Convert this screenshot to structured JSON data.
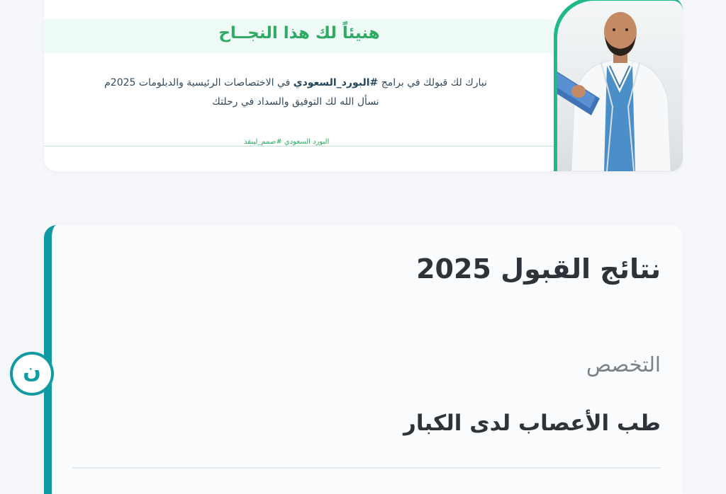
{
  "banner": {
    "title": "هنيئاً لك هذا النجــاح",
    "line1_prefix": "نبارك لك قبولك في برامج ",
    "line1_hashtag": "#البورد_السعودي",
    "line1_suffix": " في الاختصاصات الرئيسية والدبلومات 2025م",
    "line2": "نسأل الله لك التوفيق والسداد في رحلتك",
    "tag": "البورد السعودي #صمم_لينقذ"
  },
  "results": {
    "title": "نتائج القبول 2025",
    "field_label": "التخصص",
    "field_value": "طب الأعصاب لدى الكبار"
  },
  "float_button": {
    "glyph": "ن"
  },
  "colors": {
    "accent_teal": "#109aa1",
    "accent_green": "#2eaa62",
    "background": "#f6f7fb"
  },
  "icons": {
    "float_button": "brand-logo-icon",
    "photo": "doctor-photo"
  }
}
